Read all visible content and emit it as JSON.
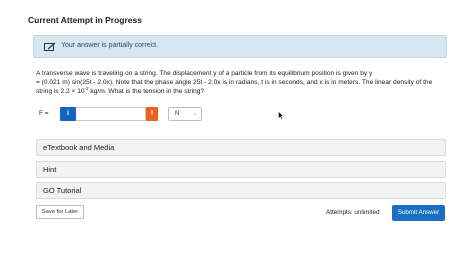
{
  "header": {
    "title": "Current Attempt in Progress"
  },
  "banner": {
    "icon": "pencil-note-icon",
    "text": "Your answer is partially correct."
  },
  "question": {
    "line1": "A transverse wave is traveling on a string. The displacement y of a particle from its equilibrium position is given by y",
    "line2": "= (0.021 m) sin(25t - 2.0x). Note that the phase angle 25t - 2.0x is in radians, t is in seconds, and x is in meters. The linear density of the",
    "line3_pre": "string is 2.2 × 10",
    "line3_exp": "-2",
    "line3_post": " kg/m. What is the tension in the string?"
  },
  "answer": {
    "label": "F =",
    "info_glyph": "i",
    "value": "",
    "warning_glyph": "!",
    "unit": "N",
    "unit_chevron": "⌄"
  },
  "panels": [
    {
      "label": "eTextbook and Media"
    },
    {
      "label": "Hint"
    },
    {
      "label": "GO Tutorial"
    }
  ],
  "footer": {
    "save_label": "Save for Later",
    "attempts_text": "Attempts: unlimited",
    "submit_label": "Submit Answer"
  },
  "colors": {
    "banner_bg": "#d6e7f1",
    "info_blue": "#1565c0",
    "warning_orange": "#e8621f",
    "submit_blue": "#1a6fc0"
  }
}
